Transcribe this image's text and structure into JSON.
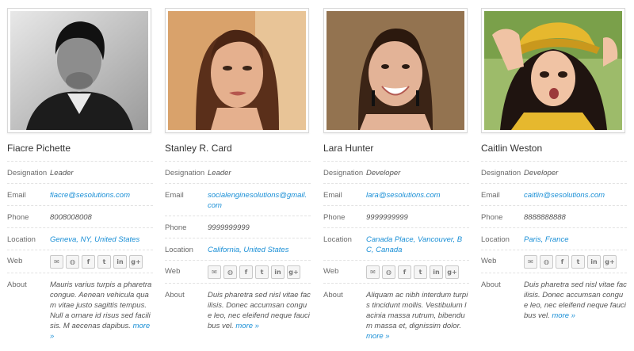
{
  "members": [
    {
      "name": "Fiacre Pichette",
      "designation_label": "Designation",
      "designation": "Leader",
      "email_label": "Email",
      "email": "fiacre@sesolutions.com",
      "phone_label": "Phone",
      "phone": "8008008008",
      "location_label": "Location",
      "location": "Geneva, NY, United States",
      "web_label": "Web",
      "about_label": "About",
      "about": "Mauris varius turpis a pharetra congue. Aenean vehicula quam vitae justo sagittis tempus. Null a ornare id risus sed facilisis. M aecenas dapibus.",
      "more": "more »"
    },
    {
      "name": "Stanley R. Card",
      "designation_label": "Designation",
      "designation": "Leader",
      "email_label": "Email",
      "email": "socialenginesolutions@gmail.com",
      "phone_label": "Phone",
      "phone": "9999999999",
      "location_label": "Location",
      "location": "California, United States",
      "web_label": "Web",
      "about_label": "About",
      "about": "Duis pharetra sed nisl vitae facilisis. Donec accumsan congue leo, nec eleifend neque faucibus vel.",
      "more": "more »"
    },
    {
      "name": "Lara Hunter",
      "designation_label": "Designation",
      "designation": "Developer",
      "email_label": "Email",
      "email": "lara@sesolutions.com",
      "phone_label": "Phone",
      "phone": "9999999999",
      "location_label": "Location",
      "location": "Canada Place, Vancouver, BC, Canada",
      "web_label": "Web",
      "about_label": "About",
      "about": "Aliquam ac nibh interdum turpis tincidunt mollis. Vestibulum lacinia massa rutrum, bibendum massa et, dignissim dolor.",
      "more": "more »"
    },
    {
      "name": "Caitlin Weston",
      "designation_label": "Designation",
      "designation": "Developer",
      "email_label": "Email",
      "email": "caitlin@sesolutions.com",
      "phone_label": "Phone",
      "phone": "8888888888",
      "location_label": "Location",
      "location": "Paris, France",
      "web_label": "Web",
      "about_label": "About",
      "about": "Duis pharetra sed nisl vitae facilisis. Donec accumsan congue leo, nec eleifend neque faucibus vel.",
      "more": "more »"
    }
  ],
  "social_icons": [
    "email-icon",
    "globe-icon",
    "facebook-icon",
    "twitter-icon",
    "linkedin-icon",
    "google-plus-icon"
  ],
  "social_glyphs": [
    "✉",
    "◍",
    "f",
    "t",
    "in",
    "g+"
  ],
  "colors": {
    "link": "#1a8fd6",
    "label": "#6b6b6b",
    "divider": "#e2e2e2"
  }
}
